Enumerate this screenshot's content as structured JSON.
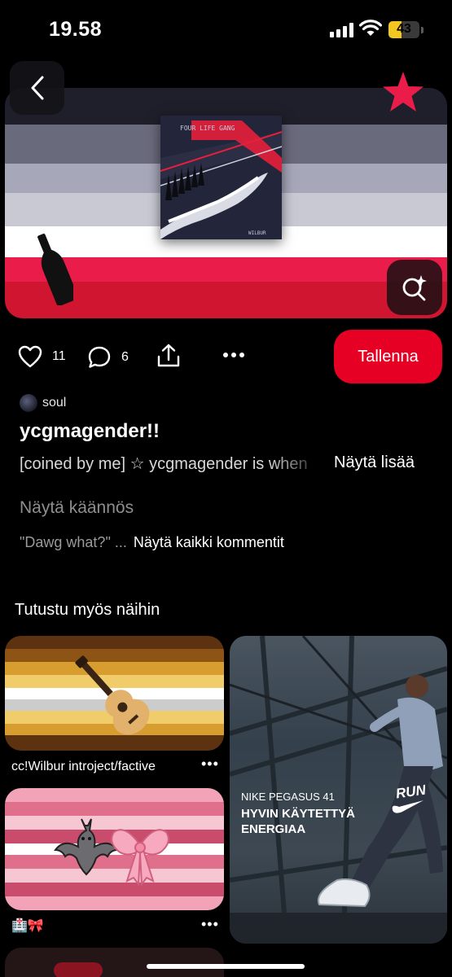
{
  "status_bar": {
    "time": "19.58",
    "battery": "43"
  },
  "pin": {
    "likes": "11",
    "comments": "6",
    "save_label": "Tallenna",
    "author": "soul",
    "title": "ycgmagender!!",
    "description": "[coined by me] ☆ ycgmagender is when",
    "show_more": "Näytä lisää",
    "translate": "Näytä käännös",
    "comment_preview": "\"Dawg what?\" ...",
    "all_comments": "Näytä kaikki kommentit",
    "album_text_top": "FOUR LIFE GANG",
    "album_text_bottom": "WILBUR"
  },
  "section": {
    "title": "Tutustu myös näihin"
  },
  "grid": [
    {
      "caption": "cc!Wilbur introject/factive"
    },
    {
      "caption": "🏥🎀"
    }
  ],
  "ad": {
    "line1": "NIKE PEGASUS 41",
    "line2": "HYVIN KÄYTETTYÄ",
    "line3": "ENERGIAA",
    "logo_text": "RUN"
  },
  "colors": {
    "accent": "#e60023",
    "hero_red": "#e8193c"
  }
}
